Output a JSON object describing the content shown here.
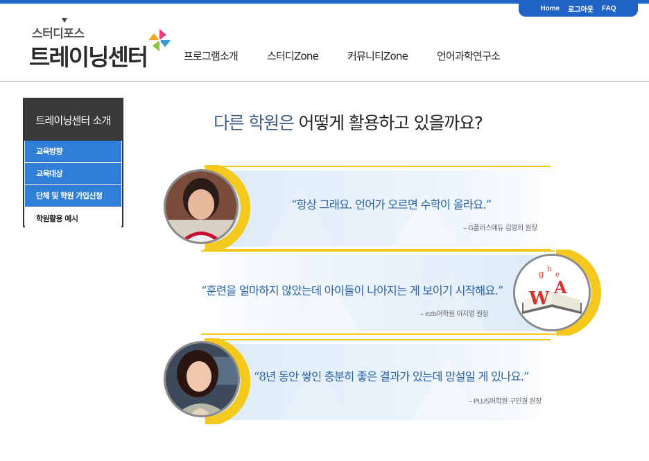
{
  "util_nav": {
    "home": "Home",
    "logout": "로그아웃",
    "faq": "FAQ"
  },
  "logo": {
    "small": "스터디포스",
    "big": "트레이닝센터"
  },
  "gnb": [
    "프로그램소개",
    "스터디Zone",
    "커뮤니티Zone",
    "언어과학연구소"
  ],
  "lnb": {
    "title": "트레이닝센터 소개",
    "items": [
      "교육방향",
      "교육대상",
      "단체 및 학원 가입신청",
      "학원활용 예시"
    ]
  },
  "headline": {
    "part1": "다른 학원은",
    "part2": " 어떻게 활용하고 있을까요?"
  },
  "testimonials": [
    {
      "quote": "“항상 그래요. 언어가 오르면 수학이 올라요.”",
      "source": "– G플러스에듀 김영희 원장"
    },
    {
      "quote": "“훈련을 얼마하지 않았는데 아이들이 나아지는 게 보이기 시작해요.”",
      "source": "– ezb어학원 이지영 원장"
    },
    {
      "quote": "“8년 동안 쌓인 충분히 좋은 결과가 있는데 망설일 게 있나요.”",
      "source": "– PLUS어학원 구민경 원장"
    }
  ],
  "colors": {
    "accent_blue": "#1f63c6",
    "menu_blue": "#2f7fd8",
    "quote_blue": "#2c63a8",
    "ring_yellow": "#f4c81c"
  }
}
